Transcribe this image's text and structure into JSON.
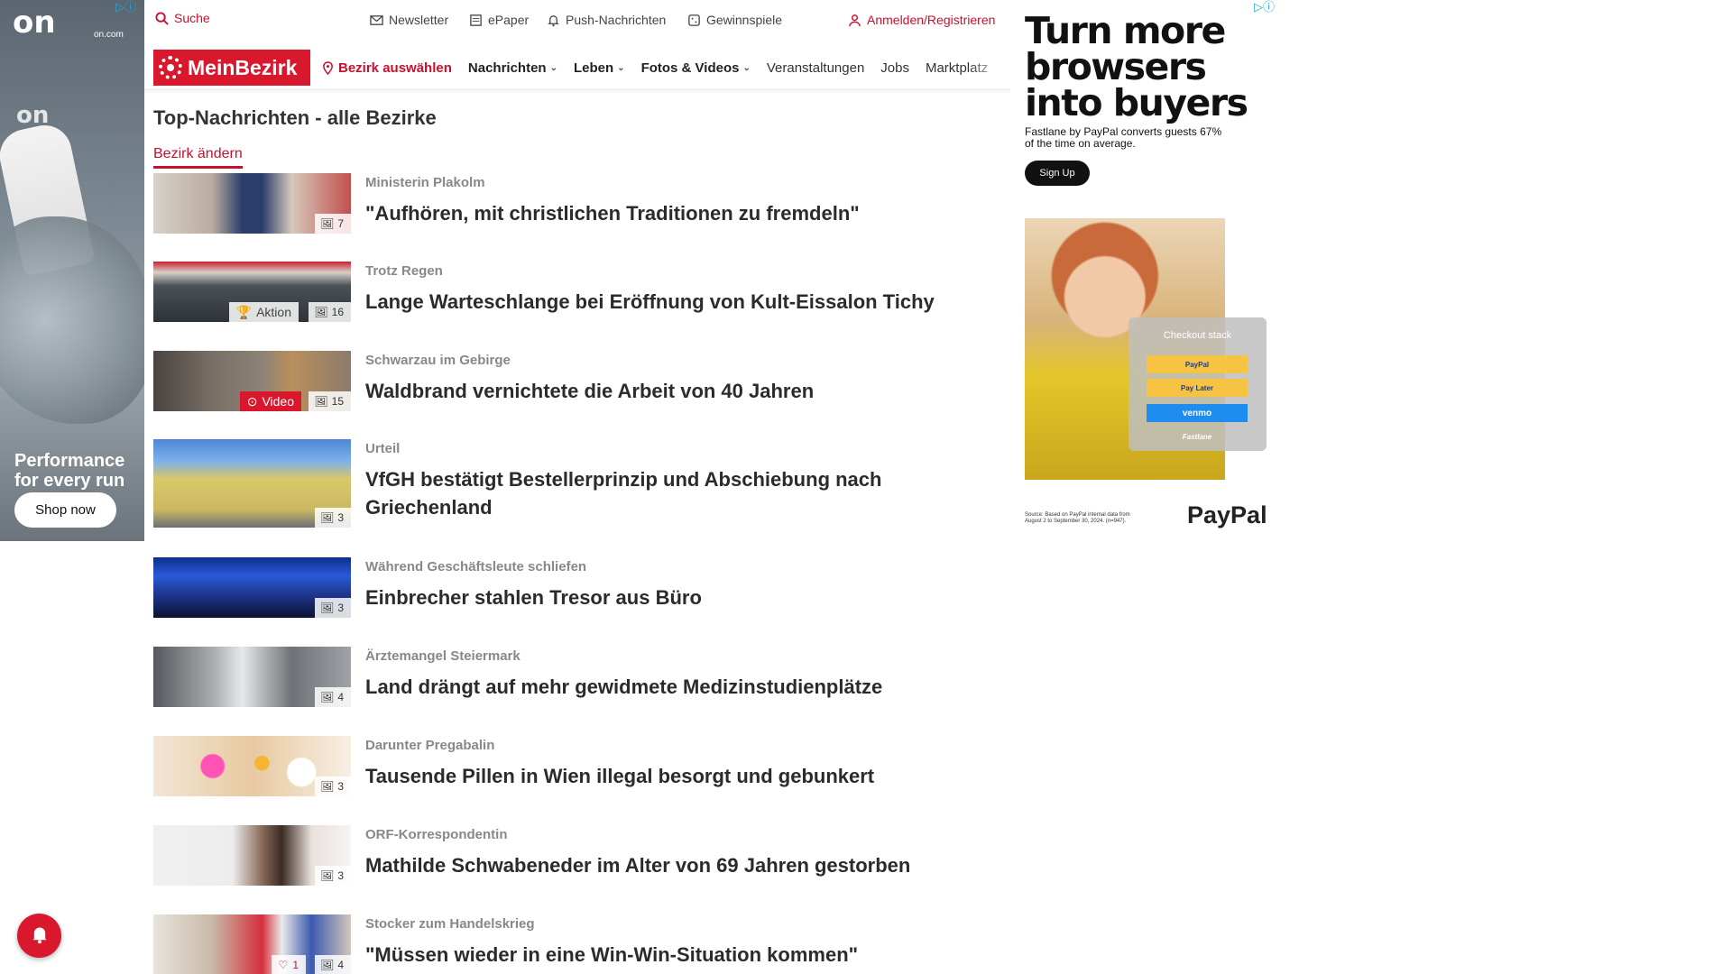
{
  "left_ad": {
    "logo": "on",
    "domain": "on.com",
    "headline_line1": "Performance",
    "headline_line2": "for every run",
    "cta": "Shop now"
  },
  "topbar": {
    "search": "Suche",
    "newsletter": "Newsletter",
    "epaper": "ePaper",
    "push": "Push-Nachrichten",
    "gewinnspiele": "Gewinnspiele",
    "login": "Anmelden/Registrieren"
  },
  "nav": {
    "brand": "MeinBezirk",
    "bezirk": "Bezirk auswählen",
    "items": [
      {
        "label": "Nachrichten",
        "dropdown": true
      },
      {
        "label": "Leben",
        "dropdown": true
      },
      {
        "label": "Fotos & Videos",
        "dropdown": true
      },
      {
        "label": "Veranstaltungen",
        "dropdown": false
      },
      {
        "label": "Jobs",
        "dropdown": false
      },
      {
        "label": "Marktplatz",
        "dropdown": false
      }
    ]
  },
  "page": {
    "title": "Top-Nachrichten - alle Bezirke",
    "change_bezirk": "Bezirk ändern"
  },
  "articles": [
    {
      "kicker": "Ministerin Plakolm",
      "headline": "\"Aufhören, mit christlichen Traditionen zu fremdeln\"",
      "photos": "7"
    },
    {
      "kicker": "Trotz Regen",
      "headline": "Lange Warteschlange bei Eröffnung von Kult-Eissalon Tichy",
      "photos": "16",
      "extra": "Aktion"
    },
    {
      "kicker": "Schwarzau im Gebirge",
      "headline": "Waldbrand vernichtete die Arbeit von 40 Jahren",
      "photos": "15",
      "extra": "Video"
    },
    {
      "kicker": "Urteil",
      "headline": "VfGH bestätigt Bestellerprinzip und Abschiebung nach Griechenland",
      "photos": "3"
    },
    {
      "kicker": "Während Geschäftsleute schliefen",
      "headline": "Einbrecher stahlen Tresor aus Büro",
      "photos": "3"
    },
    {
      "kicker": "Ärztemangel Steiermark",
      "headline": "Land drängt auf mehr gewidmete Medizinstudienplätze",
      "photos": "4"
    },
    {
      "kicker": "Darunter Pregabalin",
      "headline": "Tausende Pillen in Wien illegal besorgt und gebunkert",
      "photos": "3"
    },
    {
      "kicker": "ORF-Korrespondentin",
      "headline": "Mathilde Schwabeneder im Alter von 69 Jahren gestorben",
      "photos": "3"
    },
    {
      "kicker": "Stocker zum Handelskrieg",
      "headline": "\"Müssen wieder in eine Win-Win-Situation kommen\"",
      "photos": "4",
      "likes": "1"
    }
  ],
  "right_ad": {
    "headline_l1": "Turn more",
    "headline_l2": "browsers",
    "headline_l3": "into buyers",
    "sub": "Fastlane by PayPal converts guests 67% of the time on average.",
    "cta": "Sign Up",
    "checkout_title": "Checkout stack",
    "btn_paypal": "PayPal",
    "btn_paylater": "Pay Later",
    "btn_venmo": "venmo",
    "btn_fastlane": "Fastlane",
    "source": "Source: Based on PayPal internal data from August 2 to September 30, 2024. (n=947).",
    "brand": "PayPal"
  },
  "colors": {
    "brand_red": "#d9182d",
    "link_red": "#c8102e"
  }
}
